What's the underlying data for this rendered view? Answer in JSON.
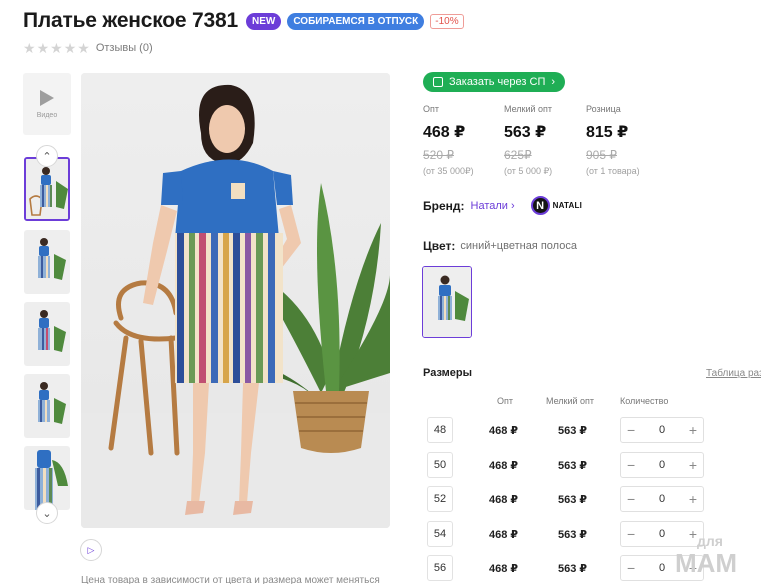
{
  "product": {
    "title": "Платье женское 7381",
    "badges": {
      "new": "NEW",
      "vacation": "СОБИРАЕМСЯ В ОТПУСК",
      "discount": "-10%"
    },
    "reviews": "Отзывы (0)"
  },
  "gallery": {
    "video_label": "Видео",
    "note": "Цена товара в зависимости от цвета и размера может меняться"
  },
  "order": {
    "button_label": "Заказать через СП"
  },
  "prices": [
    {
      "label": "Опт",
      "current": "468 ₽",
      "old": "520 ₽",
      "min": "(от 35 000₽)"
    },
    {
      "label": "Мелкий опт",
      "current": "563 ₽",
      "old": "625₽",
      "min": "(от 5 000 ₽)"
    },
    {
      "label": "Розница",
      "current": "815 ₽",
      "old": "905 ₽",
      "min": "(от 1 товара)"
    }
  ],
  "brand": {
    "label": "Бренд:",
    "link": "Натали",
    "logo_text": "NATALI"
  },
  "color": {
    "label": "Цвет:",
    "value": "синий+цветная полоса"
  },
  "sizes": {
    "title": "Размеры",
    "table_link": "Таблица раз",
    "headers": {
      "opt": "Опт",
      "small_opt": "Мелкий опт",
      "qty": "Количество"
    },
    "rows": [
      {
        "size": "48",
        "opt": "468 ₽",
        "small": "563 ₽",
        "qty": "0"
      },
      {
        "size": "50",
        "opt": "468 ₽",
        "small": "563 ₽",
        "qty": "0"
      },
      {
        "size": "52",
        "opt": "468 ₽",
        "small": "563 ₽",
        "qty": "0"
      },
      {
        "size": "54",
        "opt": "468 ₽",
        "small": "563 ₽",
        "qty": "0"
      },
      {
        "size": "56",
        "opt": "468 ₽",
        "small": "563 ₽",
        "qty": "0"
      }
    ]
  },
  "watermark": {
    "line1": "для",
    "line2": "МАМ"
  },
  "colors": {
    "accent": "#6c3dd8",
    "order_green": "#1fae55",
    "badge_blue": "#3f7ee0",
    "discount_red": "#e2524a"
  }
}
